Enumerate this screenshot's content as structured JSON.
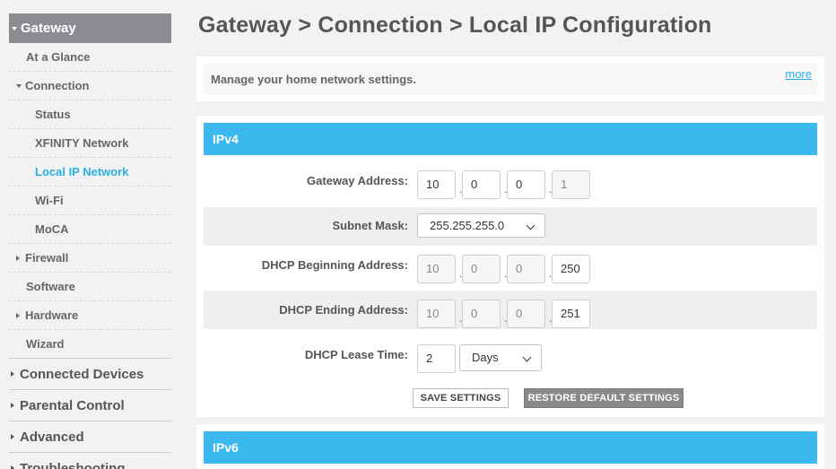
{
  "sidebar": {
    "gateway": "Gateway",
    "at_a_glance": "At a Glance",
    "connection": "Connection",
    "status": "Status",
    "xfinity_network": "XFINITY Network",
    "local_ip_network": "Local IP Network",
    "wifi": "Wi-Fi",
    "moca": "MoCA",
    "firewall": "Firewall",
    "software": "Software",
    "hardware": "Hardware",
    "wizard": "Wizard",
    "connected_devices": "Connected Devices",
    "parental_control": "Parental Control",
    "advanced": "Advanced",
    "troubleshooting": "Troubleshooting"
  },
  "page": {
    "title": "Gateway > Connection > Local IP Configuration",
    "info_text": "Manage your home network settings.",
    "more_link": "more"
  },
  "ipv4": {
    "heading": "IPv4",
    "gateway_address_label": "Gateway Address:",
    "gateway_address": [
      "10",
      "0",
      "0",
      "1"
    ],
    "subnet_mask_label": "Subnet Mask:",
    "subnet_mask": "255.255.255.0",
    "dhcp_begin_label": "DHCP Beginning Address:",
    "dhcp_begin": [
      "10",
      "0",
      "0",
      "250"
    ],
    "dhcp_end_label": "DHCP Ending Address:",
    "dhcp_end": [
      "10",
      "0",
      "0",
      "251"
    ],
    "lease_time_label": "DHCP Lease Time:",
    "lease_time_value": "2",
    "lease_time_unit": "Days",
    "dot": ".",
    "save_button": "SAVE SETTINGS",
    "restore_button": "RESTORE DEFAULT SETTINGS"
  },
  "ipv6": {
    "heading": "IPv6"
  },
  "colors": {
    "accent": "#3bb8ee",
    "active_link": "#29b1e4",
    "sidebar_active_bg": "#8a8c8f"
  }
}
